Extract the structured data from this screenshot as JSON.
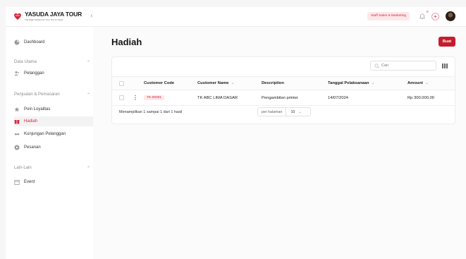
{
  "brand": {
    "name": "YASUDA JAYA TOUR",
    "tagline": "The Right Solution for Your Tour & Travel",
    "accent_color": "#c51d2c"
  },
  "header": {
    "role": "Staff Sales & Marketing",
    "notification_count": "0",
    "icons": [
      "collapse-icon",
      "bell-icon",
      "plus-icon",
      "avatar"
    ]
  },
  "sidebar": {
    "dashboard": "Dashboard",
    "sections": [
      {
        "title": "Data Utama",
        "items": [
          "Pelanggan"
        ]
      },
      {
        "title": "Penjualan & Pemasaran",
        "items": [
          "Poin Loyalitas",
          "Hadiah",
          "Kunjungan Pelanggan",
          "Pesanan"
        ]
      },
      {
        "title": "Lain-Lain",
        "items": [
          "Event"
        ]
      }
    ],
    "active_item": "Hadiah"
  },
  "page": {
    "title": "Hadiah",
    "create_label": "Buat",
    "search_placeholder": "Cari"
  },
  "table": {
    "columns": [
      "Customer Code",
      "Customer Name",
      "Description",
      "Tanggal Pelaksanaan",
      "Amount"
    ],
    "rows": [
      {
        "customer_code": "TK-00001",
        "customer_name": "TK ABC LIMA DASAR",
        "description": "Pengambilan printer",
        "tanggal": "14/07/2024",
        "amount": "Rp 300.000,00"
      }
    ]
  },
  "pagination": {
    "summary": "Menampilkan 1 sampai 1 dari 1 hasil",
    "per_page_label": "per halaman",
    "per_page_value": "10"
  }
}
